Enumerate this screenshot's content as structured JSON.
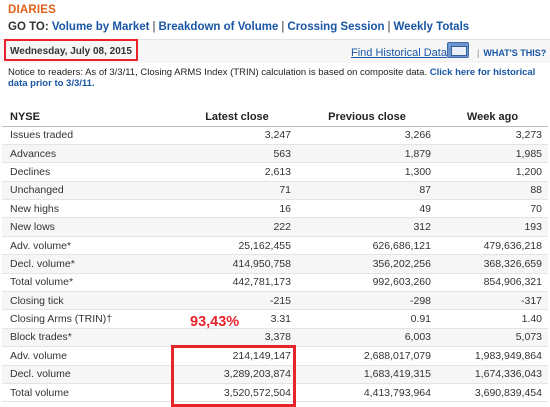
{
  "header": {
    "title": "DIARIES",
    "goto_label": "GO TO:",
    "links": [
      "Volume by Market",
      "Breakdown of Volume",
      "Crossing Session",
      "Weekly Totals"
    ]
  },
  "datebar": {
    "date": "Wednesday, July 08, 2015",
    "historical_link": "Find Historical Data",
    "historical_icon": "calendar-icon",
    "whats_this": "WHAT'S THIS?"
  },
  "notice": {
    "text": "Notice to readers: As of 3/3/11, Closing ARMS Index (TRIN) calculation is based on composite data.",
    "link": "Click here for historical data prior to 3/3/11."
  },
  "table": {
    "columns": [
      "NYSE",
      "Latest close",
      "Previous close",
      "Week ago"
    ],
    "rows": [
      [
        "Issues traded",
        "3,247",
        "3,266",
        "3,273"
      ],
      [
        "Advances",
        "563",
        "1,879",
        "1,985"
      ],
      [
        "Declines",
        "2,613",
        "1,300",
        "1,200"
      ],
      [
        "Unchanged",
        "71",
        "87",
        "88"
      ],
      [
        "New highs",
        "16",
        "49",
        "70"
      ],
      [
        "New lows",
        "222",
        "312",
        "193"
      ],
      [
        "Adv. volume*",
        "25,162,455",
        "626,686,121",
        "479,636,218"
      ],
      [
        "Decl. volume*",
        "414,950,758",
        "356,202,256",
        "368,326,659"
      ],
      [
        "Total volume*",
        "442,781,173",
        "992,603,260",
        "854,906,321"
      ],
      [
        "Closing tick",
        "-215",
        "-298",
        "-317"
      ],
      [
        "Closing Arms (TRIN)†",
        "3.31",
        "0.91",
        "1.40"
      ],
      [
        "Block trades*",
        "3,378",
        "6,003",
        "5,073"
      ],
      [
        "Adv. volume",
        "214,149,147",
        "2,688,017,079",
        "1,983,949,864"
      ],
      [
        "Decl. volume",
        "3,289,203,874",
        "1,683,419,315",
        "1,674,336,043"
      ],
      [
        "Total volume",
        "3,520,572,504",
        "4,413,793,964",
        "3,690,839,454"
      ]
    ]
  },
  "annotation": {
    "percent": "93,43%",
    "highlight_color": "#e8242b"
  },
  "colors": {
    "accent_orange": "#e0611a",
    "link_blue": "#1a56a6"
  }
}
